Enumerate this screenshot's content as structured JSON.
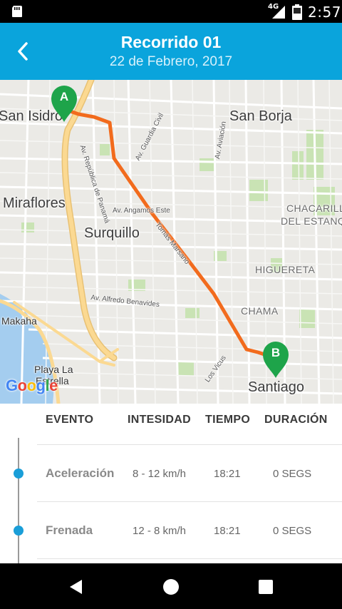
{
  "status_bar": {
    "network": "4G",
    "time": "2:57"
  },
  "app_bar": {
    "title": "Recorrido 01",
    "subtitle": "22 de Febrero, 2017"
  },
  "map": {
    "districts": [
      "San Isidro",
      "San Borja",
      "Miraflores",
      "Surquillo",
      "CHACARILLA",
      "DEL ESTANQUE",
      "HIGUERETA",
      "CHAMA",
      "Santiago",
      "Makaha",
      "Playa La",
      "Estrella"
    ],
    "streets": [
      "Av. República de Panamá",
      "Av. Guardia Civil",
      "Av. Aviación",
      "Av. Angamos Este",
      "Tomás Marsano",
      "Av. Alfredo Benavides",
      "Los Vicus"
    ],
    "marker_start": "A",
    "marker_end": "B",
    "attribution": "Google",
    "route_color": "#f26b1d",
    "marker_color": "#1ea44a"
  },
  "table": {
    "headers": [
      "EVENTO",
      "INTESIDAD",
      "TIEMPO",
      "DURACIÓN"
    ],
    "rows": [
      {
        "evento": "Aceleración",
        "intensidad": "8 - 12 km/h",
        "tiempo": "18:21",
        "duracion": "0 SEGS"
      },
      {
        "evento": "Frenada",
        "intensidad": "12 - 8 km/h",
        "tiempo": "18:21",
        "duracion": "0 SEGS"
      }
    ]
  },
  "colors": {
    "app_bar": "#0aa4dc",
    "timeline_dot": "#1a9ed8"
  }
}
